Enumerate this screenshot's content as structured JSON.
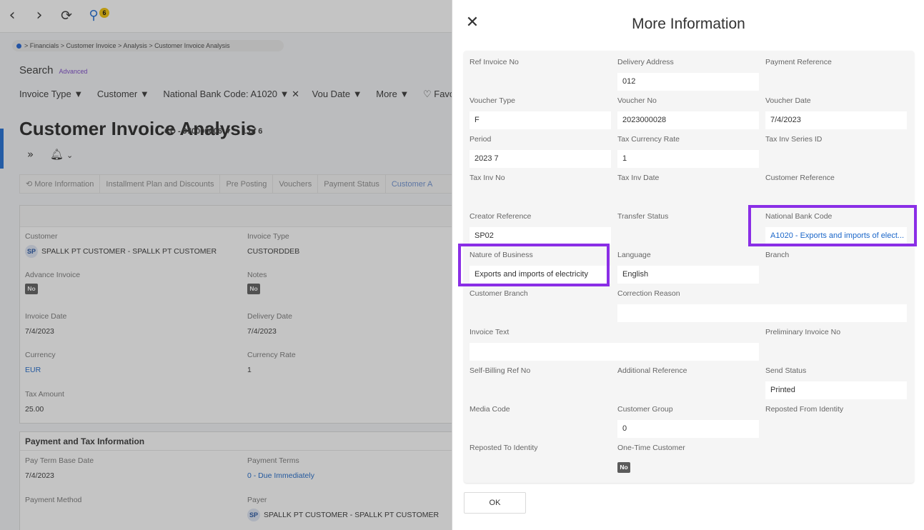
{
  "topbar": {
    "back_icon": "chevron-left-icon",
    "forward_icon": "chevron-right-icon",
    "refresh_icon": "refresh-icon",
    "notifications_icon": "search-notification-icon",
    "notification_count": "6"
  },
  "breadcrumb": {
    "text": "> Financials > Customer Invoice > Analysis > Customer Invoice Analysis"
  },
  "search": {
    "label": "Search",
    "advanced": "Advanced"
  },
  "filters": {
    "invoice_type": "Invoice Type ▼",
    "customer": "Customer ▼",
    "national_bank_code": "National Bank Code: A1020 ▼ ✕",
    "vou_date": "Vou Date ▼",
    "more": "More ▼",
    "favorites": "♡ Favor"
  },
  "page": {
    "title": "Customer Invoice Analysis",
    "record": "CD - 970000006 ▼",
    "count": "1 of 6"
  },
  "tabs": {
    "more_information": "⟲ More Information",
    "installment": "Installment Plan and Discounts",
    "pre_posting": "Pre Posting",
    "vouchers": "Vouchers",
    "payment_status": "Payment Status",
    "customer_a": "Customer A"
  },
  "background_fields": {
    "customer_label": "Customer",
    "customer_avatar": "SP",
    "customer_value": "SPALLK PT CUSTOMER - SPALLK PT CUSTOMER",
    "invoice_type_label": "Invoice Type",
    "invoice_type_value": "CUSTORDDEB",
    "advance_invoice_label": "Advance Invoice",
    "advance_invoice_value": "No",
    "notes_label": "Notes",
    "notes_value": "No",
    "invoice_date_label": "Invoice Date",
    "invoice_date_value": "7/4/2023",
    "delivery_date_label": "Delivery Date",
    "delivery_date_value": "7/4/2023",
    "currency_label": "Currency",
    "currency_value": "EUR",
    "currency_rate_label": "Currency Rate",
    "currency_rate_value": "1",
    "tax_amount_label": "Tax Amount",
    "tax_amount_value": "25.00",
    "payment_section_title": "Payment and Tax Information",
    "pay_term_base_date_label": "Pay Term Base Date",
    "pay_term_base_date_value": "7/4/2023",
    "payment_terms_label": "Payment Terms",
    "payment_terms_value": "0 - Due Immediately",
    "payment_method_label": "Payment Method",
    "payer_label": "Payer",
    "payer_avatar": "SP",
    "payer_value": "SPALLK PT CUSTOMER - SPALLK PT CUSTOMER"
  },
  "panel": {
    "title": "More Information",
    "ok_label": "OK",
    "fields": {
      "ref_invoice_no": {
        "label": "Ref Invoice No",
        "value": ""
      },
      "delivery_address": {
        "label": "Delivery Address",
        "value": "012"
      },
      "payment_reference": {
        "label": "Payment Reference",
        "value": ""
      },
      "voucher_type": {
        "label": "Voucher Type",
        "value": "F"
      },
      "voucher_no": {
        "label": "Voucher No",
        "value": "2023000028"
      },
      "voucher_date": {
        "label": "Voucher Date",
        "value": "7/4/2023"
      },
      "period": {
        "label": "Period",
        "value": "2023 7"
      },
      "tax_currency_rate": {
        "label": "Tax Currency Rate",
        "value": "1"
      },
      "tax_inv_series_id": {
        "label": "Tax Inv Series ID",
        "value": ""
      },
      "tax_inv_no": {
        "label": "Tax Inv No",
        "value": ""
      },
      "tax_inv_date": {
        "label": "Tax Inv Date",
        "value": ""
      },
      "customer_reference": {
        "label": "Customer Reference",
        "value": ""
      },
      "creator_reference": {
        "label": "Creator Reference",
        "value": "SP02"
      },
      "transfer_status": {
        "label": "Transfer Status",
        "value": ""
      },
      "national_bank_code": {
        "label": "National Bank Code",
        "value": "A1020 - Exports and imports of elect..."
      },
      "nature_of_business": {
        "label": "Nature of Business",
        "value": "Exports and imports of electricity"
      },
      "language": {
        "label": "Language",
        "value": "English"
      },
      "branch": {
        "label": "Branch",
        "value": ""
      },
      "customer_branch": {
        "label": "Customer Branch",
        "value": ""
      },
      "correction_reason": {
        "label": "Correction Reason",
        "value": ""
      },
      "invoice_text": {
        "label": "Invoice Text",
        "value": ""
      },
      "preliminary_invoice_no": {
        "label": "Preliminary Invoice No",
        "value": ""
      },
      "self_billing_ref_no": {
        "label": "Self-Billing Ref No",
        "value": ""
      },
      "additional_reference": {
        "label": "Additional Reference",
        "value": ""
      },
      "send_status": {
        "label": "Send Status",
        "value": "Printed"
      },
      "media_code": {
        "label": "Media Code",
        "value": ""
      },
      "customer_group": {
        "label": "Customer Group",
        "value": "0"
      },
      "reposted_from_identity": {
        "label": "Reposted From Identity",
        "value": ""
      },
      "reposted_to_identity": {
        "label": "Reposted To Identity",
        "value": ""
      },
      "one_time_customer": {
        "label": "One-Time Customer",
        "value": "No"
      }
    }
  },
  "colors": {
    "highlight": "#8a2ee6",
    "link": "#1a66c9",
    "accent": "#1b6ad3"
  }
}
